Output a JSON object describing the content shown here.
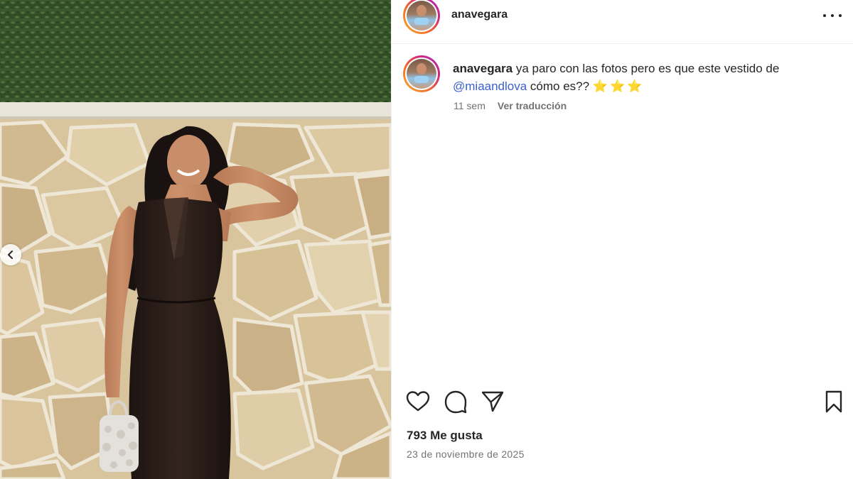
{
  "post": {
    "username": "anavegara",
    "caption": {
      "username": "anavegara",
      "text_before": " ya paro con las fotos pero es que este vestido de ",
      "mention": "@miaandlova",
      "text_after": " cómo es?? ",
      "stars": "⭐⭐⭐"
    },
    "meta": {
      "age": "11 sem",
      "translate": "Ver traducción"
    },
    "likes": "793 Me gusta",
    "date": "23 de noviembre de 2025"
  },
  "icons": {
    "more": "more-options-icon",
    "like": "heart-icon",
    "comment": "comment-icon",
    "share": "share-icon",
    "save": "bookmark-icon",
    "prev": "chevron-left-icon"
  },
  "colors": {
    "mention": "#3b5fcf",
    "muted": "#737373",
    "text": "#262626",
    "avatar_ring": "#d3287a"
  }
}
